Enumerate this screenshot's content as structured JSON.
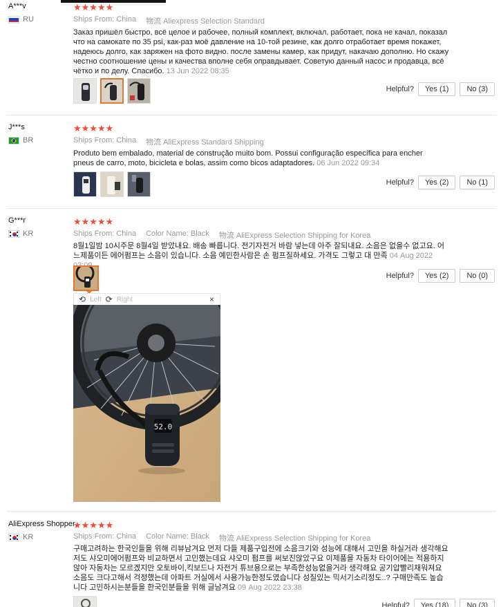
{
  "colors": {
    "star": "#f24a39",
    "accent": "#e6762c"
  },
  "helpful_label": "Helpful?",
  "reviews": [
    {
      "user": "A***v",
      "country": "RU",
      "stars": "★★★★★",
      "ships_from_label": "Ships From:",
      "ships_from": "China",
      "shipping_label": "物流",
      "shipping": "Aliexpress Selection Standard",
      "text": "Заказ пришёл быстро, всё целое и рабочее, полный комплект, включал, работает, пока не качал, показал что на самокате по 35 psi, как-раз моё давление на 10-той резине, как долго отработает время покажет, надеюсь долго, как заряжен на фото видно. после замены камер, как придут, накачаю дополню. Но скажу честно соотношение цены и качества вполне себя оправдывает. Советую данный насос и продавца, всё чётко и по делу. Спасибо.",
      "date": "13 Jun 2022 08:35",
      "yes": "Yes (1)",
      "no": "No (3)"
    },
    {
      "user": "J***s",
      "country": "BR",
      "stars": "★★★★★",
      "ships_from_label": "Ships From:",
      "ships_from": "China",
      "shipping_label": "物流",
      "shipping": "AliExpress Standard Shipping",
      "text": "Produto bem embalado, material de construção muito bom. Possui configuração específica para encher pneus de carro, moto, bicicleta e bolas, assim como bicos adaptadores.",
      "date": "06 Jun 2022 09:34",
      "yes": "Yes (2)",
      "no": "No (1)"
    },
    {
      "user": "G***r",
      "country": "KR",
      "stars": "★★★★★",
      "ships_from_label": "Ships From:",
      "ships_from": "China",
      "color_label": "Color Name:",
      "color": "Black",
      "shipping_label": "物流",
      "shipping": "AliExpress Selection Shipping for Korea",
      "text": "8월1일밤 10시주문 8월4일 받았내요. 배송 빠릅니다. 전기자전거 바람 넣는데 아주 잘되내요. 소음은 없을수 없고요. 어느제품이든 에어펌프는 소음이 있습니다. 소음 예민한사람은 손 펌프질하세요. 가격도 그렇고 대 만족",
      "date": "04 Aug 2022 03:09",
      "yes": "Yes (2)",
      "no": "No (0)",
      "viewer": {
        "left": "Left",
        "right": "Right",
        "close": "×",
        "display": "52.0"
      }
    },
    {
      "user": "AliExpress Shopper",
      "country": "KR",
      "stars": "★★★★★",
      "ships_from_label": "Ships From:",
      "ships_from": "China",
      "color_label": "Color Name:",
      "color": "Black",
      "shipping_label": "物流",
      "shipping": "AliExpress Selection Shipping for Korea",
      "text": "구매고려하는 한국인들을 위해 리뷰남겨요 먼저 다들 제품구입전에 소음크기와 성능에 대해서 고민을 하실거라 생각해요 저도 샤오미에어펌프와 비교하면서 고민했는데요 샤오미 펌프를 써보진않았구요 이제품을 자동차 타이어에는 적용하지않아 자동차는 모르겠지만 오토바이,킥보드나 자전거 튜브용으로는 부족한성능없을거라 생각해요 공기압빨리채워져요 소음도 크다고해서 걱정했는데 아파트 거실에서 사용가능한정도였습니다 성질있는 믹서기소리정도..? 구매만족도 높습니다 고민하시는분들을 한국인분들을 위해 글남겨요",
      "date": "09 Aug 2022 23:38",
      "yes": "Yes (18)",
      "no": "No (3)"
    }
  ]
}
